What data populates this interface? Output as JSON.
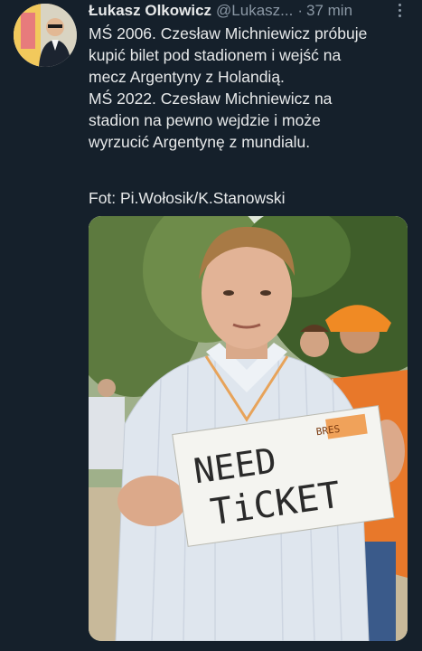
{
  "tweet": {
    "author_name": "Łukasz Olkowicz",
    "author_handle": "@Lukasz...",
    "separator": "·",
    "time": "37 min",
    "text_lines": [
      "MŚ 2006. Czesław Michniewicz próbuje",
      "kupić bilet pod stadionem i wejść na",
      "mecz Argentyny z Holandią.",
      "MŚ 2022. Czesław Michniewicz na",
      "stadion na pewno wejdzie i może",
      "wyrzucić Argentynę z mundialu."
    ],
    "credit": "Fot: Pi.Wołosik/K.Stanowski"
  },
  "photo": {
    "sign_line1": "NEED",
    "sign_line2": "TiCKET",
    "sticker": "BRES"
  },
  "colors": {
    "background": "#15202b",
    "text": "#e7e9ea",
    "muted": "#8b98a5"
  },
  "icons": {
    "more": "more-vertical-icon"
  }
}
